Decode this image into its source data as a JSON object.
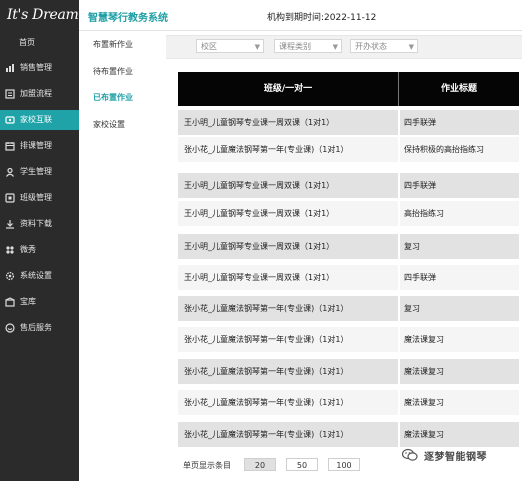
{
  "brand": {
    "logo_text": "It's Dream"
  },
  "sidebar": {
    "items": [
      {
        "label": "首页",
        "icon": "home-icon"
      },
      {
        "label": "销售管理",
        "icon": "sales-icon"
      },
      {
        "label": "加盟流程",
        "icon": "franchise-icon"
      },
      {
        "label": "家校互联",
        "icon": "home-school-icon",
        "active": true
      },
      {
        "label": "排课管理",
        "icon": "schedule-icon"
      },
      {
        "label": "学生管理",
        "icon": "student-icon"
      },
      {
        "label": "班级管理",
        "icon": "class-icon"
      },
      {
        "label": "资料下载",
        "icon": "download-icon"
      },
      {
        "label": "微秀",
        "icon": "share-icon"
      },
      {
        "label": "系统设置",
        "icon": "settings-icon"
      },
      {
        "label": "宝库",
        "icon": "treasure-icon"
      },
      {
        "label": "售后服务",
        "icon": "service-icon"
      }
    ]
  },
  "header": {
    "system_title": "智慧琴行教务系统",
    "expiry_text": "机构到期时间:2022-11-12"
  },
  "submenu": {
    "items": [
      {
        "label": "布置新作业"
      },
      {
        "label": "待布置作业"
      },
      {
        "label": "已布置作业",
        "active": true
      },
      {
        "label": "家校设置"
      }
    ]
  },
  "filters": {
    "campus": "校区",
    "course_type": "课程类别",
    "open_status": "开办状态"
  },
  "table": {
    "headers": [
      "班级/一对一",
      "作业标题"
    ],
    "rows": [
      [
        "王小明_儿童钢琴专业课一周双课（1对1）",
        "四手联弹"
      ],
      [
        "张小花_儿童魔法钢琴第一年(专业课)（1对1）",
        "保持积极的高抬指练习"
      ],
      [
        "王小明_儿童钢琴专业课一周双课（1对1）",
        "四手联弹"
      ],
      [
        "王小明_儿童钢琴专业课一周双课（1对1）",
        "高抬指练习"
      ],
      [
        "王小明_儿童钢琴专业课一周双课（1对1）",
        "复习"
      ],
      [
        "王小明_儿童钢琴专业课一周双课（1对1）",
        "四手联弹"
      ],
      [
        "张小花_儿童魔法钢琴第一年(专业课)（1对1）",
        "复习"
      ],
      [
        "张小花_儿童魔法钢琴第一年(专业课)（1对1）",
        "魔法课复习"
      ],
      [
        "张小花_儿童魔法钢琴第一年(专业课)（1对1）",
        "魔法课复习"
      ],
      [
        "张小花_儿童魔法钢琴第一年(专业课)（1对1）",
        "魔法课复习"
      ],
      [
        "张小花_儿童魔法钢琴第一年(专业课)（1对1）",
        "魔法课复习"
      ]
    ]
  },
  "pager": {
    "label": "单页显示条目",
    "options": [
      "20",
      "50",
      "100"
    ],
    "selected": "20"
  },
  "watermark": {
    "text": "逐梦智能钢琴"
  },
  "colors": {
    "accent": "#1fa3a8",
    "sidebar_bg": "#2b2b2b",
    "header_bg": "#050505"
  }
}
